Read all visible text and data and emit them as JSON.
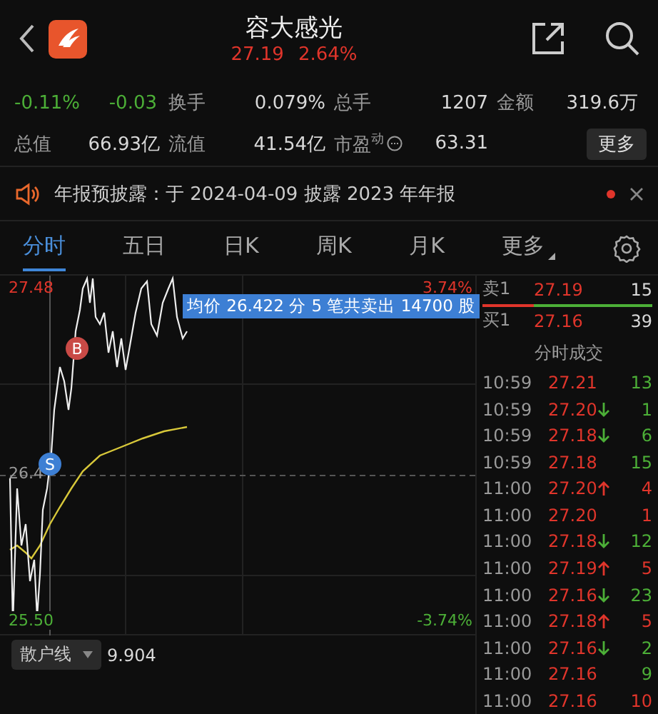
{
  "header": {
    "title": "容大感光",
    "price": "27.19",
    "change_pct": "2.64%"
  },
  "change": [
    {
      "value": "-0.11%",
      "color": "#4caf37"
    },
    {
      "value": "-0.03",
      "color": "#4caf37"
    }
  ],
  "stats": [
    [
      {
        "label": "换手",
        "value": "0.079%"
      },
      {
        "label": "总手",
        "value": "1207"
      },
      {
        "label": "金额",
        "value": "319.6万"
      }
    ],
    [
      {
        "label": "总值",
        "value": "66.93亿"
      },
      {
        "label": "流值",
        "value": "41.54亿"
      },
      {
        "label": "市盈$^{动}$",
        "value": "63.31",
        "info": true
      }
    ]
  ],
  "more_button": "更多",
  "notice": {
    "text": "年报预披露：于 2024-04-09 披露 2023 年年报",
    "unread": true
  },
  "tabs": [
    {
      "label": "分时",
      "selected": true,
      "dropdown": false
    },
    {
      "label": "五日",
      "selected": false,
      "dropdown": false
    },
    {
      "label": "日K",
      "selected": false,
      "dropdown": false
    },
    {
      "label": "周K",
      "selected": false,
      "dropdown": false
    },
    {
      "label": "月K",
      "selected": false,
      "dropdown": false
    },
    {
      "label": "更多",
      "selected": false,
      "dropdown": true
    }
  ],
  "chart": {
    "high": "27.48",
    "high_pct": "3.74%",
    "mid": "26.4",
    "low": "25.50",
    "low_pct": "-3.74%",
    "tooltip": "均价 26.422  分 5 笔共卖出 14700 股",
    "markers": [
      {
        "label": "B",
        "kind": "buy"
      },
      {
        "label": "S",
        "kind": "sell"
      }
    ]
  },
  "indicator": {
    "label": "散户线",
    "value": "9.904"
  },
  "order_book": {
    "rows": [
      {
        "label": "卖1",
        "price": "27.19",
        "volume": "15"
      },
      {
        "label": "买1",
        "price": "27.16",
        "volume": "39"
      }
    ],
    "level": 0.3
  },
  "trades": {
    "title": "分时成交",
    "rows": [
      {
        "time": "10:59",
        "price": "27.21",
        "kind": "plain",
        "volume": "13",
        "color": "#4caf37"
      },
      {
        "time": "10:59",
        "price": "27.20",
        "kind": "down",
        "volume": "1",
        "color": "#4caf37"
      },
      {
        "time": "10:59",
        "price": "27.18",
        "kind": "down",
        "volume": "6",
        "color": "#4caf37"
      },
      {
        "time": "10:59",
        "price": "27.18",
        "kind": "plain",
        "volume": "15",
        "color": "#4caf37"
      },
      {
        "time": "11:00",
        "price": "27.20",
        "kind": "up",
        "volume": "4",
        "color": "#e0352b"
      },
      {
        "time": "11:00",
        "price": "27.20",
        "kind": "plain",
        "volume": "1",
        "color": "#e0352b"
      },
      {
        "time": "11:00",
        "price": "27.18",
        "kind": "down",
        "volume": "12",
        "color": "#4caf37"
      },
      {
        "time": "11:00",
        "price": "27.19",
        "kind": "up",
        "volume": "5",
        "color": "#e0352b"
      },
      {
        "time": "11:00",
        "price": "27.16",
        "kind": "down",
        "volume": "23",
        "color": "#4caf37"
      },
      {
        "time": "11:00",
        "price": "27.18",
        "kind": "up",
        "volume": "5",
        "color": "#e0352b"
      },
      {
        "time": "11:00",
        "price": "27.16",
        "kind": "down",
        "volume": "2",
        "color": "#4caf37"
      },
      {
        "time": "11:00",
        "price": "27.16",
        "kind": "plain",
        "volume": "9",
        "color": "#4caf37"
      },
      {
        "time": "11:00",
        "price": "27.16",
        "kind": "plain",
        "volume": "10",
        "color": "#e0352b"
      }
    ]
  }
}
